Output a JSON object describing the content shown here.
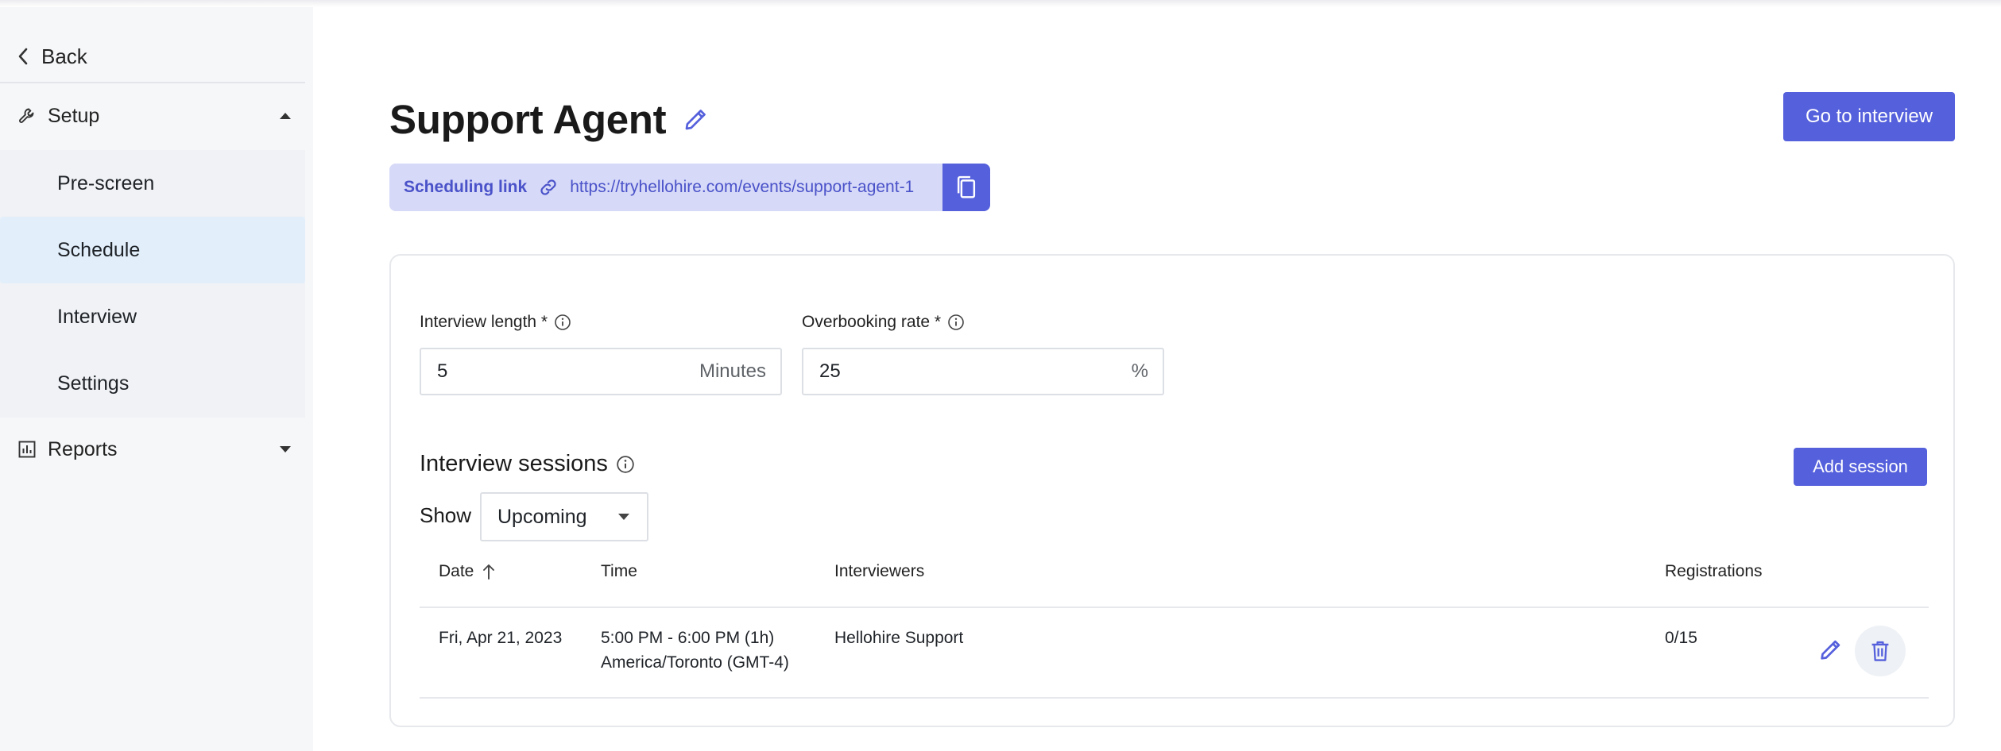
{
  "sidebar": {
    "back_label": "Back",
    "setup_label": "Setup",
    "items": [
      {
        "label": "Pre-screen"
      },
      {
        "label": "Schedule"
      },
      {
        "label": "Interview"
      },
      {
        "label": "Settings"
      }
    ],
    "reports_label": "Reports"
  },
  "header": {
    "title": "Support Agent",
    "go_button": "Go to interview"
  },
  "scheduling": {
    "label": "Scheduling link",
    "url": "https://tryhellohire.com/events/support-agent-1"
  },
  "form": {
    "length_label": "Interview length *",
    "length_value": "5",
    "length_unit": "Minutes",
    "overbook_label": "Overbooking rate *",
    "overbook_value": "25",
    "overbook_unit": "%"
  },
  "sessions": {
    "title": "Interview sessions",
    "add_button": "Add session",
    "show_label": "Show",
    "filter_value": "Upcoming",
    "columns": [
      "Date",
      "Time",
      "Interviewers",
      "Registrations"
    ],
    "rows": [
      {
        "date": "Fri, Apr 21, 2023",
        "time_line1": "5:00 PM - 6:00 PM (1h)",
        "time_line2": "America/Toronto (GMT-4)",
        "interviewers": "Hellohire Support",
        "registrations": "0/15"
      }
    ]
  },
  "colors": {
    "accent": "#5560dc",
    "link_bg": "#d6d9f7",
    "active_nav": "#e2effb",
    "sidebar_bg": "#f6f7f9"
  }
}
